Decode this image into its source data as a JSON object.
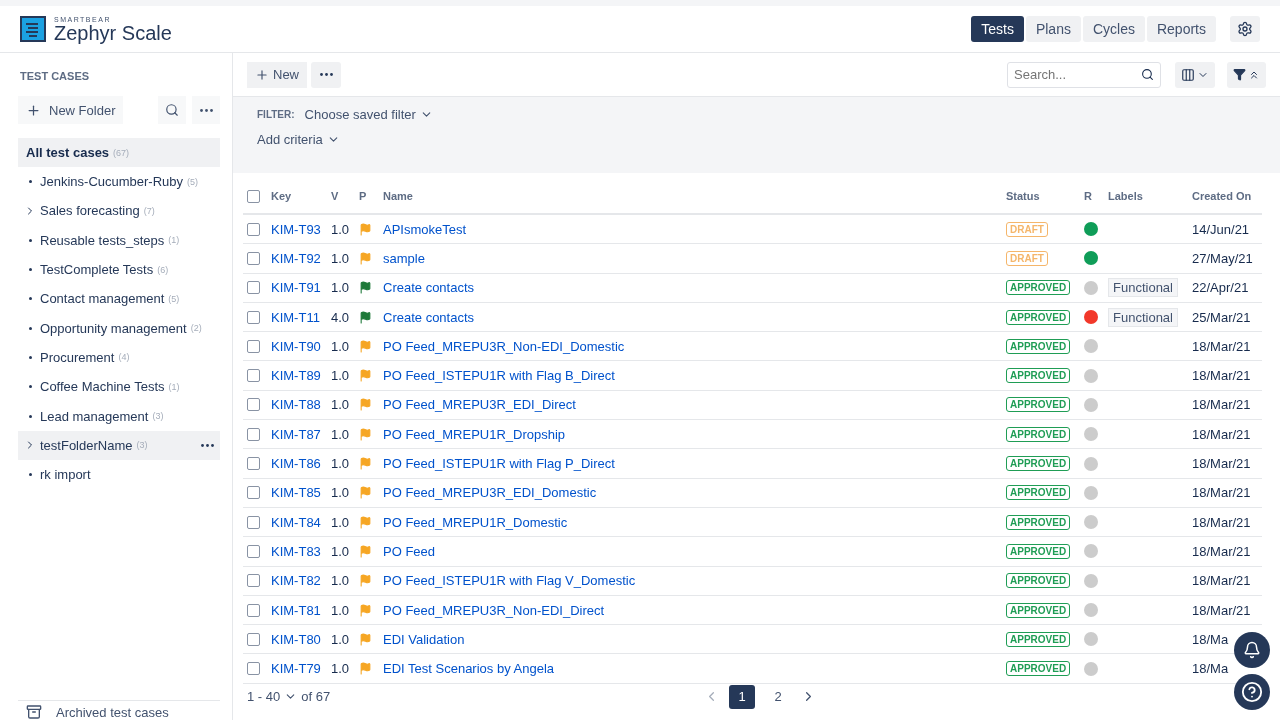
{
  "brand": {
    "company": "SMARTBEAR",
    "product": "Zephyr Scale"
  },
  "nav_tabs": [
    {
      "label": "Tests",
      "selected": true
    },
    {
      "label": "Plans",
      "selected": false
    },
    {
      "label": "Cycles",
      "selected": false
    },
    {
      "label": "Reports",
      "selected": false
    }
  ],
  "sidebar": {
    "title": "TEST CASES",
    "new_folder": "New Folder",
    "root": {
      "label": "All test cases",
      "count": "(67)",
      "selected": true
    },
    "items": [
      {
        "label": "Jenkins-Cucumber-Ruby",
        "count": "(5)",
        "kind": "leaf",
        "hovered": false
      },
      {
        "label": "Sales forecasting",
        "count": "(7)",
        "kind": "group",
        "hovered": false
      },
      {
        "label": "Reusable tests_steps",
        "count": "(1)",
        "kind": "leaf",
        "hovered": false
      },
      {
        "label": "TestComplete Tests",
        "count": "(6)",
        "kind": "leaf",
        "hovered": false
      },
      {
        "label": "Contact management",
        "count": "(5)",
        "kind": "leaf",
        "hovered": false
      },
      {
        "label": "Opportunity management",
        "count": "(2)",
        "kind": "leaf",
        "hovered": false
      },
      {
        "label": "Procurement",
        "count": "(4)",
        "kind": "leaf",
        "hovered": false
      },
      {
        "label": "Coffee Machine Tests",
        "count": "(1)",
        "kind": "leaf",
        "hovered": false
      },
      {
        "label": "Lead management",
        "count": "(3)",
        "kind": "leaf",
        "hovered": false
      },
      {
        "label": "testFolderName",
        "count": "(3)",
        "kind": "group",
        "hovered": true
      },
      {
        "label": "rk import",
        "kind": "leaf",
        "hovered": false
      }
    ],
    "archived": "Archived test cases"
  },
  "toolbar": {
    "new": "New",
    "search_placeholder": "Search..."
  },
  "filter": {
    "label": "FILTER:",
    "saved": "Choose saved filter",
    "criteria": "Add criteria"
  },
  "table": {
    "columns": [
      "Key",
      "V",
      "P",
      "Name",
      "Status",
      "R",
      "Labels",
      "Created On"
    ],
    "select_all": {
      "checked": false
    },
    "rows": [
      {
        "checked": false,
        "key": "KIM-T93",
        "version": "1.0",
        "priority": {
          "color": "#f6a623"
        },
        "name": "APIsmokeTest",
        "status": {
          "label": "DRAFT",
          "kind": "draft"
        },
        "relevance": {
          "color": "#0f9d58"
        },
        "created": "14/Jun/21"
      },
      {
        "checked": false,
        "key": "KIM-T92",
        "version": "1.0",
        "priority": {
          "color": "#f6a623"
        },
        "name": "sample",
        "status": {
          "label": "DRAFT",
          "kind": "draft"
        },
        "relevance": {
          "color": "#0f9d58"
        },
        "created": "27/May/21"
      },
      {
        "checked": false,
        "key": "KIM-T91",
        "version": "1.0",
        "priority": {
          "color": "#1f7a3a"
        },
        "name": "Create contacts",
        "status": {
          "label": "APPROVED",
          "kind": "approved"
        },
        "relevance": {
          "color": "#cccccc"
        },
        "label": "Functional",
        "created": "22/Apr/21"
      },
      {
        "checked": false,
        "key": "KIM-T11",
        "version": "4.0",
        "priority": {
          "color": "#1f7a3a"
        },
        "name": "Create contacts",
        "status": {
          "label": "APPROVED",
          "kind": "approved"
        },
        "relevance": {
          "color": "#f2382a"
        },
        "label": "Functional",
        "created": "25/Mar/21"
      },
      {
        "checked": false,
        "key": "KIM-T90",
        "version": "1.0",
        "priority": {
          "color": "#f6a623"
        },
        "name": "PO Feed_MREPU3R_Non-EDI_Domestic",
        "status": {
          "label": "APPROVED",
          "kind": "approved"
        },
        "relevance": {
          "color": "#cccccc"
        },
        "created": "18/Mar/21"
      },
      {
        "checked": false,
        "key": "KIM-T89",
        "version": "1.0",
        "priority": {
          "color": "#f6a623"
        },
        "name": "PO Feed_ISTEPU1R with Flag B_Direct",
        "status": {
          "label": "APPROVED",
          "kind": "approved"
        },
        "relevance": {
          "color": "#cccccc"
        },
        "created": "18/Mar/21"
      },
      {
        "checked": false,
        "key": "KIM-T88",
        "version": "1.0",
        "priority": {
          "color": "#f6a623"
        },
        "name": "PO Feed_MREPU3R_EDI_Direct",
        "status": {
          "label": "APPROVED",
          "kind": "approved"
        },
        "relevance": {
          "color": "#cccccc"
        },
        "created": "18/Mar/21"
      },
      {
        "checked": false,
        "key": "KIM-T87",
        "version": "1.0",
        "priority": {
          "color": "#f6a623"
        },
        "name": "PO Feed_MREPU1R_Dropship",
        "status": {
          "label": "APPROVED",
          "kind": "approved"
        },
        "relevance": {
          "color": "#cccccc"
        },
        "created": "18/Mar/21"
      },
      {
        "checked": false,
        "key": "KIM-T86",
        "version": "1.0",
        "priority": {
          "color": "#f6a623"
        },
        "name": "PO Feed_ISTEPU1R with Flag P_Direct",
        "status": {
          "label": "APPROVED",
          "kind": "approved"
        },
        "relevance": {
          "color": "#cccccc"
        },
        "created": "18/Mar/21"
      },
      {
        "checked": false,
        "key": "KIM-T85",
        "version": "1.0",
        "priority": {
          "color": "#f6a623"
        },
        "name": "PO Feed_MREPU3R_EDI_Domestic",
        "status": {
          "label": "APPROVED",
          "kind": "approved"
        },
        "relevance": {
          "color": "#cccccc"
        },
        "created": "18/Mar/21"
      },
      {
        "checked": false,
        "key": "KIM-T84",
        "version": "1.0",
        "priority": {
          "color": "#f6a623"
        },
        "name": "PO Feed_MREPU1R_Domestic",
        "status": {
          "label": "APPROVED",
          "kind": "approved"
        },
        "relevance": {
          "color": "#cccccc"
        },
        "created": "18/Mar/21"
      },
      {
        "checked": false,
        "key": "KIM-T83",
        "version": "1.0",
        "priority": {
          "color": "#f6a623"
        },
        "name": "PO Feed",
        "status": {
          "label": "APPROVED",
          "kind": "approved"
        },
        "relevance": {
          "color": "#cccccc"
        },
        "created": "18/Mar/21"
      },
      {
        "checked": false,
        "key": "KIM-T82",
        "version": "1.0",
        "priority": {
          "color": "#f6a623"
        },
        "name": "PO Feed_ISTEPU1R with Flag V_Domestic",
        "status": {
          "label": "APPROVED",
          "kind": "approved"
        },
        "relevance": {
          "color": "#cccccc"
        },
        "created": "18/Mar/21"
      },
      {
        "checked": false,
        "key": "KIM-T81",
        "version": "1.0",
        "priority": {
          "color": "#f6a623"
        },
        "name": "PO Feed_MREPU3R_Non-EDI_Direct",
        "status": {
          "label": "APPROVED",
          "kind": "approved"
        },
        "relevance": {
          "color": "#cccccc"
        },
        "created": "18/Mar/21"
      },
      {
        "checked": false,
        "key": "KIM-T80",
        "version": "1.0",
        "priority": {
          "color": "#f6a623"
        },
        "name": "EDI Validation",
        "status": {
          "label": "APPROVED",
          "kind": "approved"
        },
        "relevance": {
          "color": "#cccccc"
        },
        "created": "18/Ma"
      },
      {
        "checked": false,
        "key": "KIM-T79",
        "version": "1.0",
        "priority": {
          "color": "#f6a623"
        },
        "name": "EDI Test Scenarios by Angela",
        "status": {
          "label": "APPROVED",
          "kind": "approved"
        },
        "relevance": {
          "color": "#cccccc"
        },
        "created": "18/Ma"
      }
    ]
  },
  "pagination": {
    "range": "1 - 40",
    "total": "of 67",
    "pages": [
      {
        "label": "1",
        "selected": true
      },
      {
        "label": "2",
        "selected": false
      }
    ]
  }
}
